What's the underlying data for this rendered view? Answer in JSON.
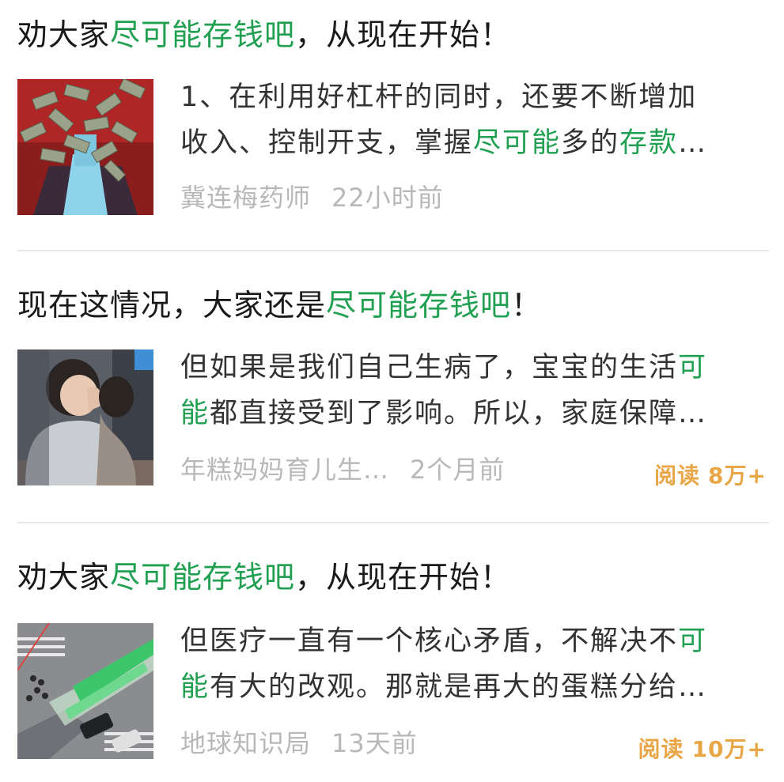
{
  "feed": {
    "items": [
      {
        "title_pre": "劝大家",
        "title_hl": "尽可能存钱吧",
        "title_post": "，从现在开始！",
        "thumbnail": "money-portrait-image",
        "snippet_line1": "1、在利用好杠杆的同时，还要不断增加",
        "snippet_line2_a": "收入、控制开支，掌握",
        "snippet_line2_hl1": "尽可能",
        "snippet_line2_b": "多的",
        "snippet_line2_hl2": "存款",
        "snippet_line2_c": "…",
        "source": "冀连梅药师",
        "time": "22小时前",
        "reads_label": "",
        "reads_count": ""
      },
      {
        "title_pre": "现在这情况，大家还是",
        "title_hl": "尽可能存钱吧",
        "title_post": "！",
        "thumbnail": "mother-and-child-image",
        "snippet_line1_a": "但如果是我们自己生病了，宝宝的生活",
        "snippet_line1_hl": "可",
        "snippet_line2_hl": "能",
        "snippet_line2_a": "都直接受到了影响。所以，家庭保障…",
        "source": "年糕妈妈育儿生…",
        "time": "2个月前",
        "reads_label": "阅读",
        "reads_count": "8万+"
      },
      {
        "title_pre": "劝大家",
        "title_hl": "尽可能存钱吧",
        "title_post": "，从现在开始！",
        "thumbnail": "city-intersection-image",
        "snippet_line1_a": "但医疗一直有一个核心矛盾，不解决不",
        "snippet_line1_hl": "可",
        "snippet_line2_hl": "能",
        "snippet_line2_a": "有大的改观。那就是再大的蛋糕分给…",
        "source": "地球知识局",
        "time": "13天前",
        "reads_label": "阅读",
        "reads_count": "10万+"
      }
    ]
  }
}
